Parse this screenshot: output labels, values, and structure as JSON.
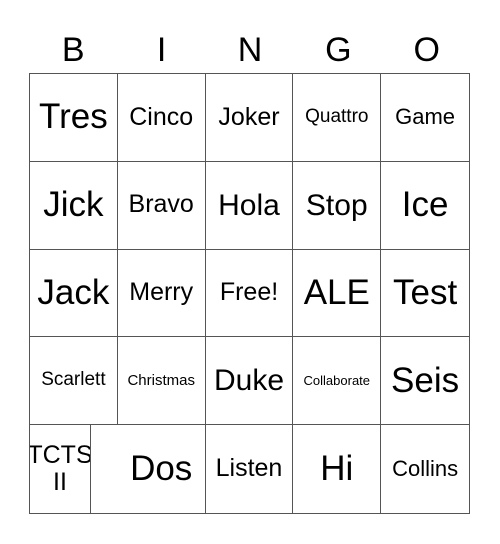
{
  "header": [
    "B",
    "I",
    "N",
    "G",
    "O"
  ],
  "cells": [
    {
      "text": "Tres",
      "size": "s36"
    },
    {
      "text": "Cinco",
      "size": "s26"
    },
    {
      "text": "Joker",
      "size": "s26"
    },
    {
      "text": "Quattro",
      "size": "s18"
    },
    {
      "text": "Game",
      "size": "s22"
    },
    {
      "text": "Jick",
      "size": "s36"
    },
    {
      "text": "Bravo",
      "size": "s26"
    },
    {
      "text": "Hola",
      "size": "s30"
    },
    {
      "text": "Stop",
      "size": "s30"
    },
    {
      "text": "Ice",
      "size": "s36"
    },
    {
      "text": "Jack",
      "size": "s36"
    },
    {
      "text": "Merry",
      "size": "s26"
    },
    {
      "text": "Free!",
      "size": "s26"
    },
    {
      "text": "ALE",
      "size": "s36"
    },
    {
      "text": "Test",
      "size": "s36"
    },
    {
      "text": "Scarlett",
      "size": "s18"
    },
    {
      "text": "Christmas",
      "size": "s16"
    },
    {
      "text": "Duke",
      "size": "s30"
    },
    {
      "text": "Collaborate",
      "size": "s13"
    },
    {
      "text": "Seis",
      "size": "s36"
    },
    {
      "text": "TCTS II",
      "size": "s26"
    },
    {
      "text": "Dos",
      "size": "s36"
    },
    {
      "text": "Listen",
      "size": "s26"
    },
    {
      "text": "Hi",
      "size": "s36"
    },
    {
      "text": "Collins",
      "size": "s22"
    }
  ]
}
